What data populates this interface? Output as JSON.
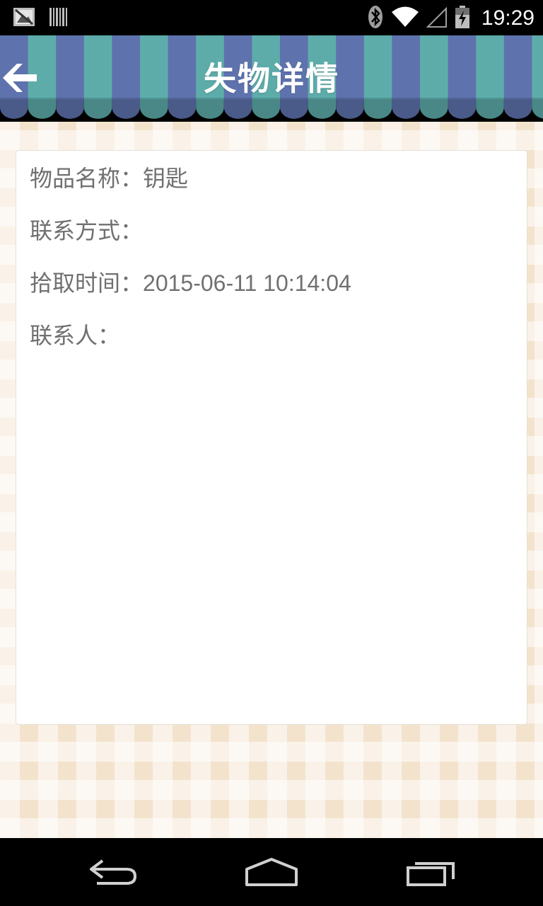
{
  "status_bar": {
    "time": "19:29",
    "left_icons": [
      "notification-image-icon",
      "barcode-icon"
    ],
    "right_icons": [
      "bluetooth-icon",
      "wifi-icon",
      "cell-signal-icon",
      "battery-charging-icon"
    ]
  },
  "header": {
    "title": "失物详情",
    "back_icon": "back-arrow-icon",
    "colors": {
      "stripe_teal": "#5dacaa",
      "stripe_blue": "#5e72ad"
    }
  },
  "details": {
    "item_name_label": "物品名称：",
    "item_name_value": "钥匙",
    "contact_method_label": "联系方式：",
    "contact_method_value": "",
    "pickup_time_label": "拾取时间：",
    "pickup_time_value": "2015-06-11 10:14:04",
    "contact_person_label": "联系人：",
    "contact_person_value": ""
  },
  "nav_bar": {
    "icons": [
      "nav-back-icon",
      "nav-home-icon",
      "nav-recent-apps-icon"
    ]
  }
}
